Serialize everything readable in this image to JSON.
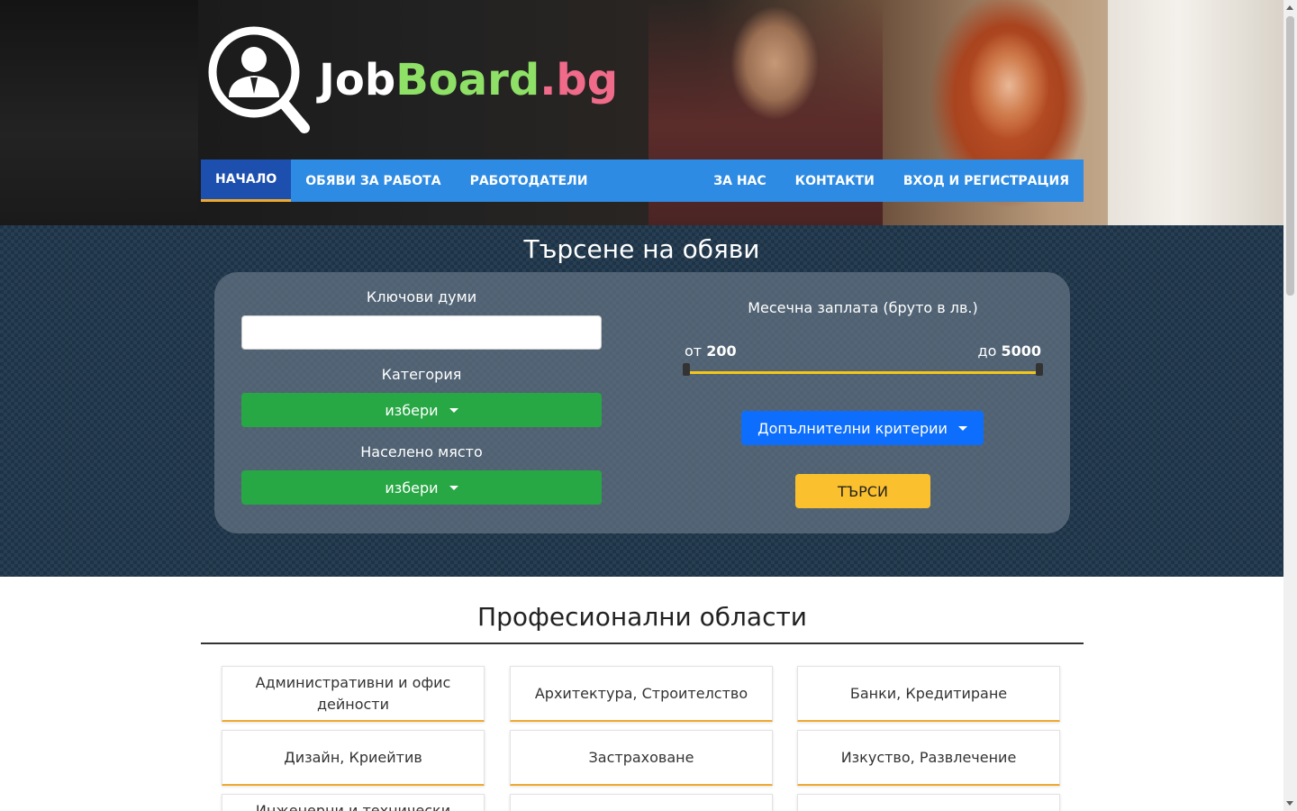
{
  "logo": {
    "part1": "Job",
    "part2": "Board",
    "part3": ".bg"
  },
  "nav": {
    "left": [
      "НАЧАЛО",
      "ОБЯВИ ЗА РАБОТА",
      "РАБОТОДАТЕЛИ"
    ],
    "right": [
      "ЗА НАС",
      "КОНТАКТИ",
      "ВХОД И РЕГИСТРАЦИЯ"
    ],
    "active_index": 0
  },
  "search": {
    "title": "Търсене на обяви",
    "keywords_label": "Ключови думи",
    "keywords_value": "",
    "category_label": "Категория",
    "category_value": "избери",
    "location_label": "Населено място",
    "location_value": "избери",
    "salary_label": "Месечна заплата (бруто в лв.)",
    "range_from_prefix": "от",
    "range_from_value": "200",
    "range_to_prefix": "до",
    "range_to_value": "5000",
    "more_criteria": "Допълнителни критерии",
    "submit": "ТЪРСИ"
  },
  "areas": {
    "title": "Професионални области",
    "items": [
      "Административни и офис дейности",
      "Архитектура, Строителство",
      "Банки, Кредитиране",
      "Дизайн, Криейтив",
      "Застраховане",
      "Изкуство, Развлечение",
      "Инженерни и технически"
    ]
  },
  "colors": {
    "nav_bg": "#2e8be3",
    "nav_active": "#1d4fae",
    "accent": "#f0a92e",
    "green": "#28a745",
    "blue_button": "#0d6efd",
    "yellow_button": "#fbc02d"
  }
}
